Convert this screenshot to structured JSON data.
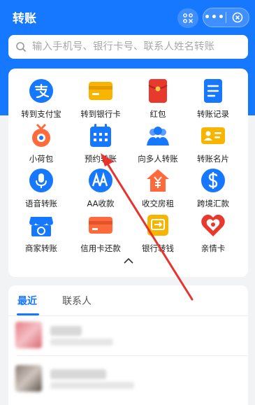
{
  "header": {
    "title": "转账",
    "more_label": "•••"
  },
  "search": {
    "placeholder": "输入手机号、银行卡号、联系人姓名转账"
  },
  "services": [
    {
      "label": "转到支付宝",
      "icon": "alipay-icon"
    },
    {
      "label": "转到银行卡",
      "icon": "bank-card-icon"
    },
    {
      "label": "红包",
      "icon": "red-envelope-icon"
    },
    {
      "label": "转账记录",
      "icon": "record-icon"
    },
    {
      "label": "小荷包",
      "icon": "pouch-icon"
    },
    {
      "label": "预约转账",
      "icon": "calendar-icon"
    },
    {
      "label": "向多人转账",
      "icon": "group-icon"
    },
    {
      "label": "转账名片",
      "icon": "business-card-icon"
    },
    {
      "label": "语音转账",
      "icon": "microphone-icon"
    },
    {
      "label": "AA收款",
      "icon": "aa-icon"
    },
    {
      "label": "收交房租",
      "icon": "house-rent-icon"
    },
    {
      "label": "跨境汇款",
      "icon": "dollar-icon"
    },
    {
      "label": "商家转账",
      "icon": "shop-icon"
    },
    {
      "label": "信用卡还款",
      "icon": "credit-card-icon"
    },
    {
      "label": "银行转钱",
      "icon": "bank-transfer-icon"
    },
    {
      "label": "亲情卡",
      "icon": "heart-card-icon"
    }
  ],
  "tabs": [
    {
      "label": "最近",
      "active": true
    },
    {
      "label": "联系人",
      "active": false
    }
  ],
  "colors": {
    "primary": "#1677ff",
    "annotation_arrow": "#e8322e"
  }
}
